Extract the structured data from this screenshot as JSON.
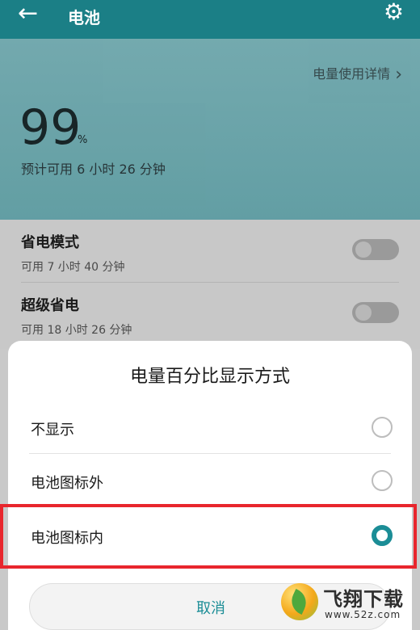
{
  "appbar": {
    "back_icon": "back-arrow-icon",
    "title": "电池",
    "settings_icon": "gear-icon"
  },
  "hero": {
    "detail_link": "电量使用详情",
    "percent": "99",
    "percent_sign": "%",
    "estimate": "预计可用 6 小时 26 分钟"
  },
  "settings": {
    "items": [
      {
        "title": "省电模式",
        "subtitle": "可用 7 小时 40 分钟",
        "enabled": false
      },
      {
        "title": "超级省电",
        "subtitle": "可用 18 小时 26 分钟",
        "enabled": false
      }
    ]
  },
  "dialog": {
    "title": "电量百分比显示方式",
    "options": [
      {
        "label": "不显示",
        "selected": false
      },
      {
        "label": "电池图标外",
        "selected": false
      },
      {
        "label": "电池图标内",
        "selected": true
      }
    ],
    "cancel": "取消"
  },
  "watermark": {
    "brand": "飞翔下载",
    "url": "www.52z.com"
  },
  "colors": {
    "appbar": "#1b7f86",
    "accent": "#1b8d96",
    "highlight": "#e8262d"
  }
}
